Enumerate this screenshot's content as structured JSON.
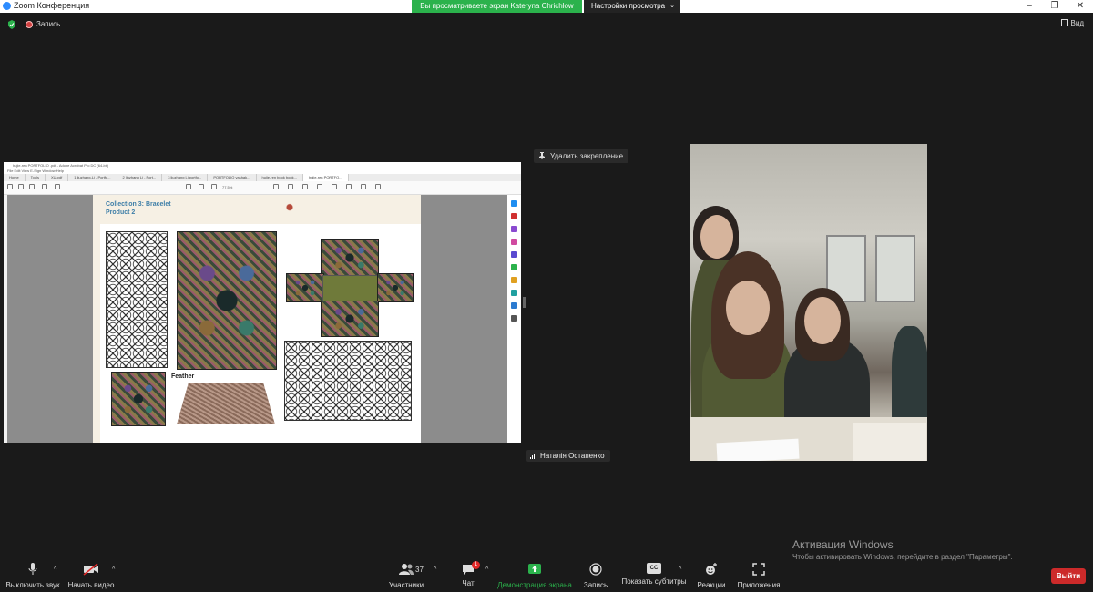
{
  "window": {
    "title": "Zoom Конференция"
  },
  "share_banner": "Вы просматриваете экран Kateryna Chrichlow",
  "view_settings": "Настройки просмотра",
  "top_bar": {
    "record_label": "Запись",
    "view_label": "Вид"
  },
  "shared_screen": {
    "acrobat_title": "hujie-ren PORTFOLIO .pdf - Adobe Acrobat Pro DC (64-bit)",
    "menu": "File  Edit  View  E-Sign  Window  Help",
    "tabs": [
      "Home",
      "Tools",
      "XU.pdf",
      "1 liuzhang-Li - Portfo...",
      "2 liuzhang Li - Port...",
      "3 liuzhang Li portfo...",
      "PORTFOLIO vashak...",
      "hujie-ren book book...",
      "hujie-ren PORTFO..."
    ],
    "zoom": "77,5%",
    "page_heading_1": "Collection 3: Bracelet",
    "page_heading_2": "Product 2",
    "feather_label": "Feather"
  },
  "unpin_label": "Удалить закрепление",
  "participant_name": "Наталія Остапенко",
  "activation": {
    "title": "Активация Windows",
    "subtitle": "Чтобы активировать Windows, перейдите в раздел \"Параметры\"."
  },
  "toolbar": {
    "mute": "Выключить звук",
    "start_video": "Начать видео",
    "participants": "Участники",
    "participants_count": "37",
    "chat": "Чат",
    "chat_badge": "1",
    "share_screen": "Демонстрация экрана",
    "record": "Запись",
    "captions": "Показать субтитры",
    "captions_icon_text": "CC",
    "reactions": "Реакции",
    "apps": "Приложения",
    "leave": "Выйти"
  },
  "colors": {
    "share_green": "#2bb24c",
    "leave_red": "#cc2a2a",
    "background": "#1a1a1a"
  }
}
